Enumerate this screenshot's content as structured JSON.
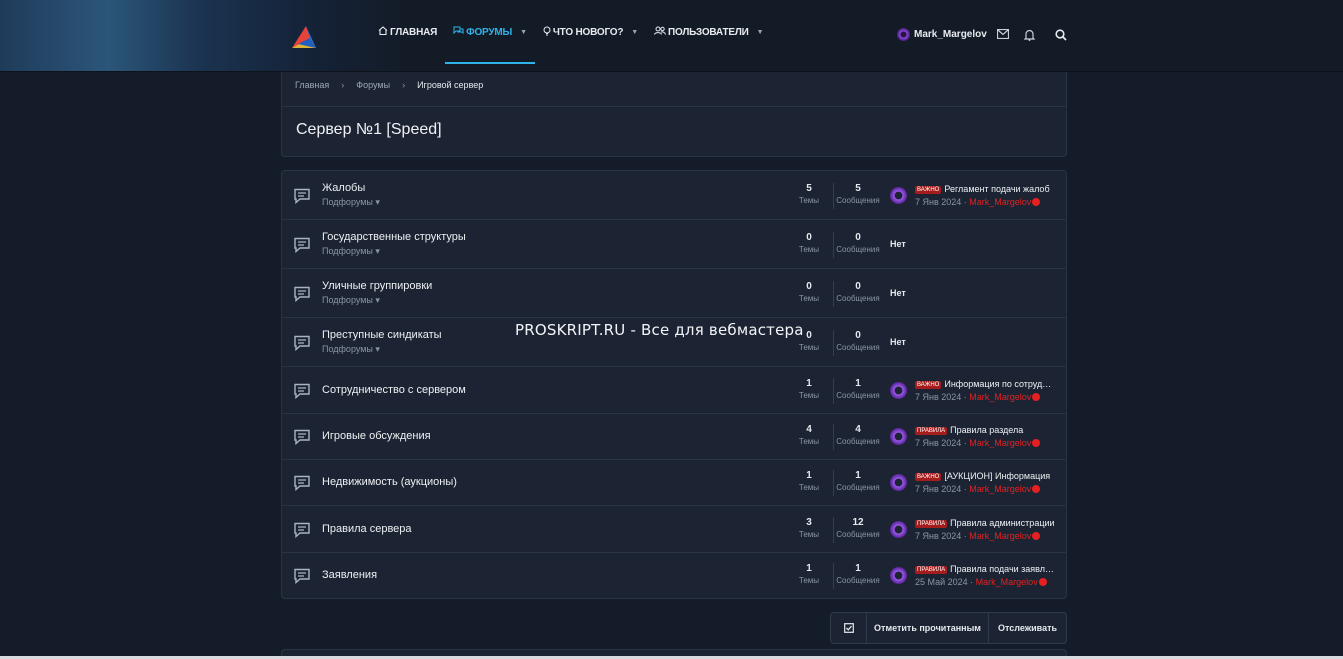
{
  "header": {
    "nav": [
      {
        "label": "Главная",
        "icon": "home-icon",
        "active": false,
        "dropdown": false
      },
      {
        "label": "Форумы",
        "icon": "chat-icon",
        "active": true,
        "dropdown": true
      },
      {
        "label": "Что нового?",
        "icon": "bulb-icon",
        "active": false,
        "dropdown": true
      },
      {
        "label": "Пользователи",
        "icon": "users-icon",
        "active": false,
        "dropdown": true
      }
    ],
    "username": "Mark_Margelov"
  },
  "breadcrumb": [
    "Главная",
    "Форумы",
    "Игровой сервер"
  ],
  "page_title": "Сервер №1 [Speed]",
  "stats_labels": {
    "threads": "Темы",
    "messages": "Сообщения"
  },
  "subforums_label": "Подфорумы",
  "empty_label": "Нет",
  "forums": [
    {
      "name": "Жалобы",
      "has_sub": true,
      "threads": "5",
      "messages": "5",
      "last": {
        "badge": "ВАЖНО",
        "title": "Регламент подачи жалоб",
        "date": "7 Янв 2024",
        "user": "Mark_Margelov"
      }
    },
    {
      "name": "Государственные структуры",
      "has_sub": true,
      "threads": "0",
      "messages": "0",
      "last": null
    },
    {
      "name": "Уличные группировки",
      "has_sub": true,
      "threads": "0",
      "messages": "0",
      "last": null
    },
    {
      "name": "Преступные синдикаты",
      "has_sub": true,
      "threads": "0",
      "messages": "0",
      "last": null
    },
    {
      "name": "Сотрудничество с сервером",
      "has_sub": false,
      "threads": "1",
      "messages": "1",
      "last": {
        "badge": "ВАЖНО",
        "title": "Информация по сотрудничеству",
        "date": "7 Янв 2024",
        "user": "Mark_Margelov"
      }
    },
    {
      "name": "Игровые обсуждения",
      "has_sub": false,
      "threads": "4",
      "messages": "4",
      "last": {
        "badge": "ПРАВИЛА",
        "title": "Правила раздела",
        "date": "7 Янв 2024",
        "user": "Mark_Margelov"
      }
    },
    {
      "name": "Недвижимость (аукционы)",
      "has_sub": false,
      "threads": "1",
      "messages": "1",
      "last": {
        "badge": "ВАЖНО",
        "title": "[АУКЦИОН] Информация",
        "date": "7 Янв 2024",
        "user": "Mark_Margelov"
      }
    },
    {
      "name": "Правила сервера",
      "has_sub": false,
      "threads": "3",
      "messages": "12",
      "last": {
        "badge": "ПРАВИЛА",
        "title": "Правила администрации",
        "date": "7 Янв 2024",
        "user": "Mark_Margelov"
      }
    },
    {
      "name": "Заявления",
      "has_sub": false,
      "threads": "1",
      "messages": "1",
      "last": {
        "badge": "ПРАВИЛА",
        "title": "Правила подачи заявлений",
        "date": "25 Май 2024",
        "user": "Mark_Margelov"
      }
    }
  ],
  "watermark": "PROSKRIPT.RU - Все для вебмастера",
  "actions": {
    "mark_read": "Отметить прочитанным",
    "watch": "Отслеживать"
  }
}
